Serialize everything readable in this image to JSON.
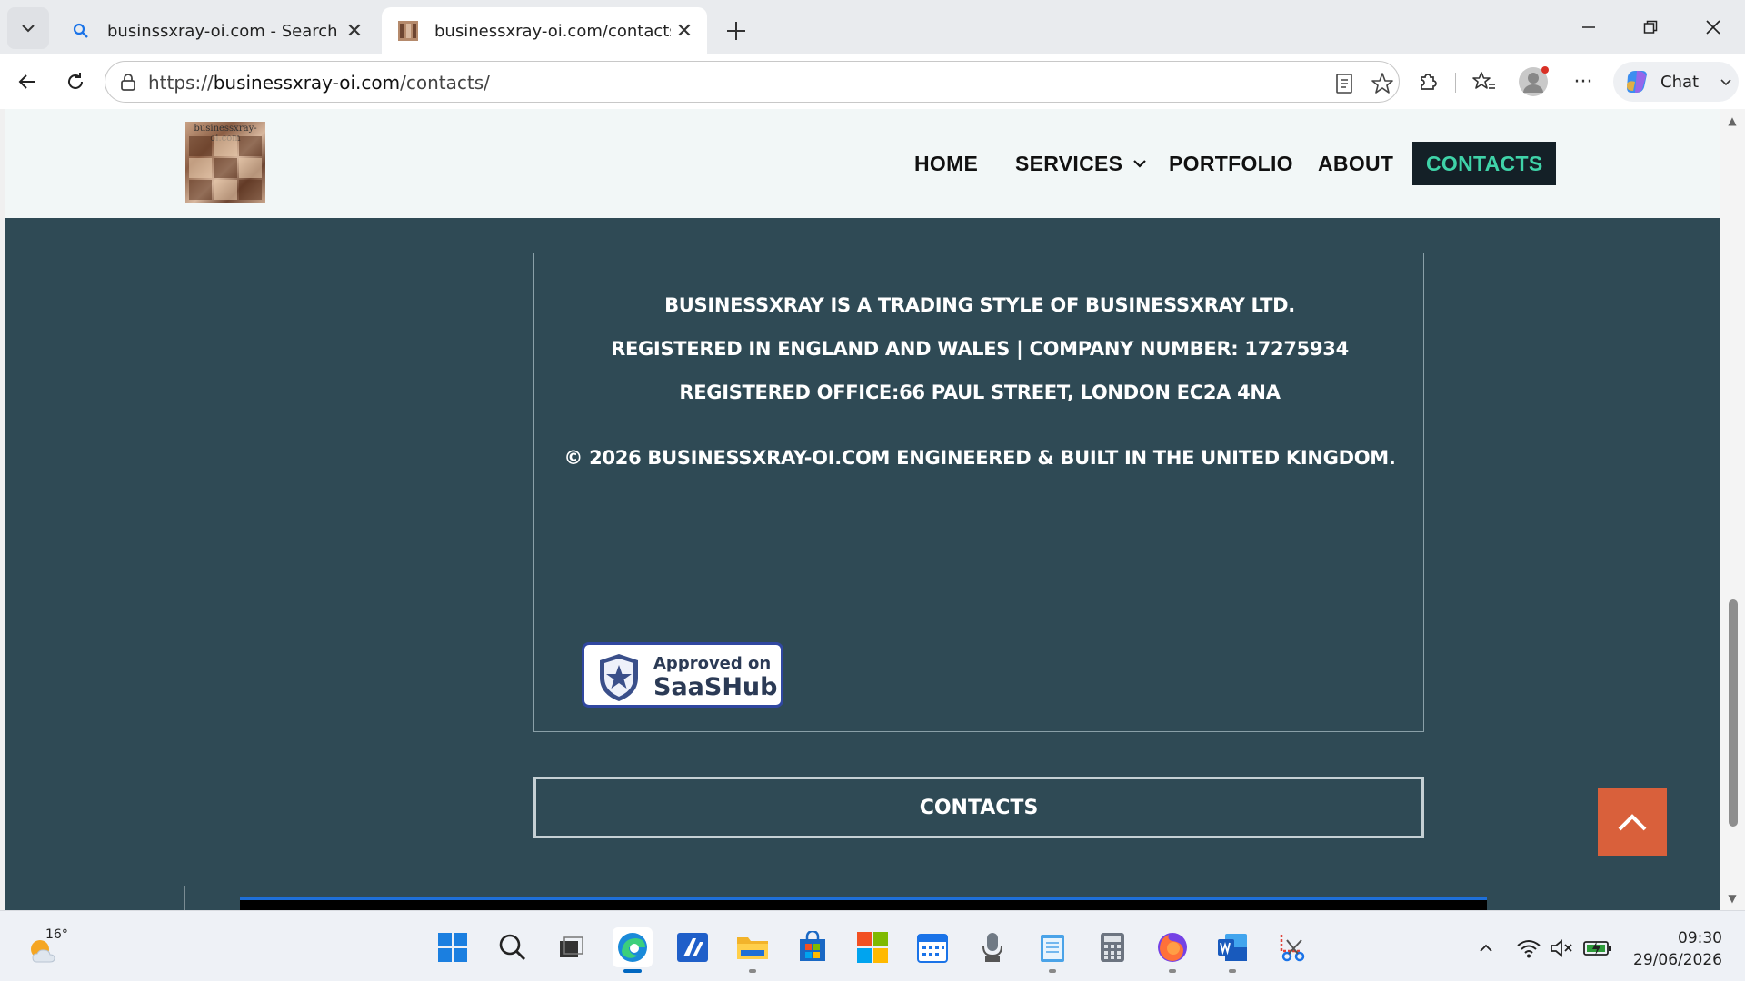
{
  "browser": {
    "tabs": [
      {
        "title": "businssxray-oi.com - Search",
        "active": false
      },
      {
        "title": "businessxray-oi.com/contacts/",
        "active": true
      }
    ],
    "url_prefix": "https://",
    "url_host": "businessxray-oi.com",
    "url_path": "/contacts/",
    "chat_label": "Chat"
  },
  "site": {
    "logo_caption": "businessxray-oi.com",
    "nav": [
      {
        "label": "HOME"
      },
      {
        "label": "SERVICES"
      },
      {
        "label": "PORTFOLIO"
      },
      {
        "label": "ABOUT"
      },
      {
        "label": "CONTACTS",
        "active": true
      }
    ],
    "footer": {
      "line1": "BUSINESSXRAY IS A TRADING STYLE OF BUSINESSXRAY LTD.",
      "line2": "REGISTERED IN ENGLAND AND WALES | COMPANY NUMBER: 17275934",
      "line3": "REGISTERED OFFICE:66 PAUL STREET, LONDON EC2A 4NA",
      "copyright": "© 2026 BUSINESSXRAY-OI.COM ENGINEERED & BUILT IN THE UNITED KINGDOM.",
      "badge_line1": "Approved on",
      "badge_line2": "SaaSHub"
    },
    "contacts_button": "CONTACTS"
  },
  "taskbar": {
    "weather_temp": "16°",
    "time": "09:30",
    "date": "29/06/2026"
  },
  "colors": {
    "page_bg": "#2f4a55",
    "header_bg": "#f2f7f7",
    "nav_active_bg": "#142027",
    "nav_active_text": "#3fd3a8",
    "to_top_bg": "#d9603b"
  }
}
